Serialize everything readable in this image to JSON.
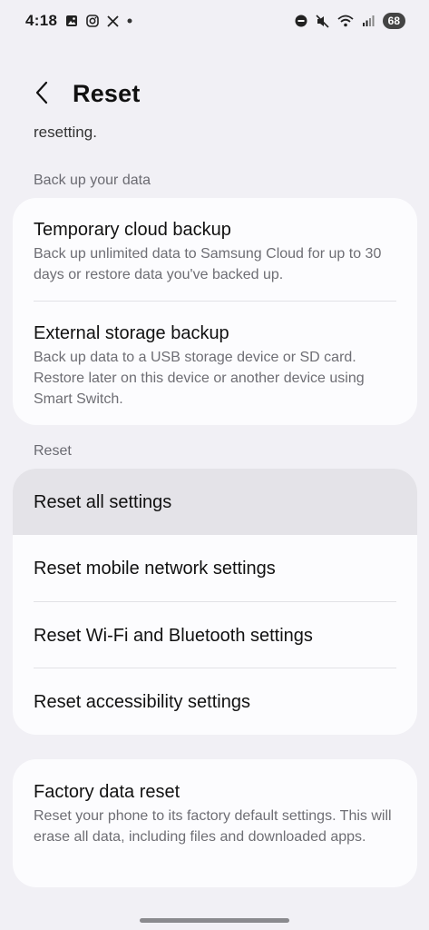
{
  "status_bar": {
    "time": "4:18",
    "battery": "68",
    "icons_left": [
      "gallery-icon",
      "instagram-icon",
      "x-icon",
      "dot-icon"
    ],
    "icons_right": [
      "dnd-icon",
      "mute-icon",
      "wifi-icon",
      "signal-icon",
      "battery-icon"
    ]
  },
  "header": {
    "title": "Reset",
    "back_icon": "chevron-left-icon"
  },
  "scrolled_text": "resetting.",
  "sections": {
    "backup": {
      "label": "Back up your data",
      "items": [
        {
          "title": "Temporary cloud backup",
          "subtitle": "Back up unlimited data to Samsung Cloud for up to 30 days or restore data you've backed up."
        },
        {
          "title": "External storage backup",
          "subtitle": "Back up data to a USB storage device or SD card. Restore later on this device or another device using Smart Switch."
        }
      ]
    },
    "reset": {
      "label": "Reset",
      "items": [
        {
          "title": "Reset all settings"
        },
        {
          "title": "Reset mobile network settings"
        },
        {
          "title": "Reset Wi-Fi and Bluetooth settings"
        },
        {
          "title": "Reset accessibility settings"
        }
      ]
    },
    "factory": {
      "items": [
        {
          "title": "Factory data reset",
          "subtitle": "Reset your phone to its factory default settings. This will erase all data, including files and downloaded apps."
        }
      ]
    }
  },
  "colors": {
    "background": "#f1f0f5",
    "card": "#fcfcfe",
    "pressed": "#e4e3e8",
    "subtext": "#6e6e74"
  }
}
